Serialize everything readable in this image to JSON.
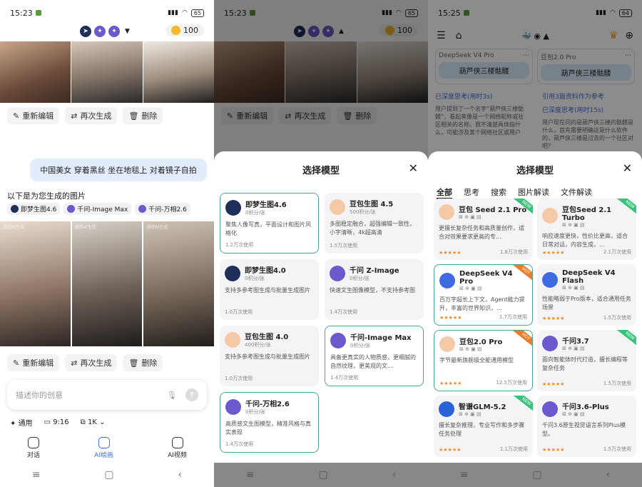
{
  "p1": {
    "time": "15:23",
    "battery": "65",
    "points": "100",
    "actions": [
      "重新编辑",
      "再次生成",
      "删除"
    ],
    "user_prompt": "中国美女 穿着黑丝 坐在地毯上 对着镜子自拍",
    "result_label": "以下是为您生成的图片",
    "model_chips": [
      "即梦生图4.6",
      "千问-Image Max",
      "千问-万相2.6"
    ],
    "watermark": "通用AI生成",
    "prompt_placeholder": "描述你的创意",
    "options": [
      "通用",
      "9:16",
      "1K"
    ],
    "nav_tabs": [
      "对话",
      "AI绘画",
      "AI视频"
    ]
  },
  "p2": {
    "time": "15:23",
    "battery": "65",
    "points": "100",
    "actions": [
      "重新编辑",
      "再次生成",
      "删除"
    ],
    "sheet_title": "选择模型",
    "cards": [
      {
        "name": "即梦生图4.6",
        "price": "0积分/张",
        "desc": "聚焦人像写真，平面设计和图片风格化",
        "uses": "1.2万次使用",
        "selected": true,
        "logo": "jimeng"
      },
      {
        "name": "豆包生图 4.5",
        "price": "500积分/张",
        "desc": "多图稳定融合，超强编辑一致性，小字清晰，4k超高清",
        "uses": "1.5万次使用",
        "selected": false,
        "logo": "doubao"
      },
      {
        "name": "即梦生图4.0",
        "price": "0积分/张",
        "desc": "支持多参考图生成与批量生成图片",
        "uses": "1.0万次使用",
        "selected": false,
        "logo": "jimeng"
      },
      {
        "name": "千问 Z-Image",
        "price": "0积分/张",
        "desc": "快速文生图像模型，不支持参考图",
        "uses": "1.4万次使用",
        "selected": false,
        "logo": "qwen"
      },
      {
        "name": "豆包生图 4.0",
        "price": "400积分/张",
        "desc": "支持多参考图生成与批量生成图片",
        "uses": "1.0万次使用",
        "selected": false,
        "logo": "doubao"
      },
      {
        "name": "千问-Image Max",
        "price": "0积分/张",
        "desc": "具备更真实的人物质感，更细腻的自然纹理，更美观的文...",
        "uses": "1.4万次使用",
        "selected": true,
        "logo": "qwen"
      },
      {
        "name": "千问-万相2.6",
        "price": "0积分/张",
        "desc": "高质感文生图模型，精准风格与真实表现",
        "uses": "1.4万次使用",
        "selected": true,
        "logo": "qwen"
      }
    ]
  },
  "p3": {
    "time": "15:25",
    "battery": "64",
    "compare": [
      {
        "model": "DeepSeek V4 Pro",
        "text": "葫芦侠三楼骷髅"
      },
      {
        "model": "豆包2.0 Pro",
        "text": "葫芦侠三楼骷髅"
      }
    ],
    "think_left": "已深度思考(用时3s)",
    "think_right": "引用3篇资料作为参考",
    "think_right2": "已深度思考(用时15s)",
    "reason_left": "用户提到了一个名字“葫芦侠三楼骷髅”，看起来像是一个网络昵称或社区相关的名称。我不清楚具体指什么，可能涉及某个网络社区或用户",
    "reason_right": "用户现在问的是葫芦侠三楼的骷髅是什么，首先需要明确这是什么软件的，葫芦侠三楼是过去的一个社区对吧？",
    "sheet_title": "选择模型",
    "tabs": [
      "全部",
      "思考",
      "搜索",
      "图片解读",
      "文件解读"
    ],
    "cards": [
      {
        "name": "豆包 Seed 2.1 Pro",
        "desc": "更擅长复杂任务和高质量创作，适合对效果要求更高的专...",
        "uses": "1.8万次使用",
        "badge": "NEW",
        "logo": "doubao",
        "selected": false
      },
      {
        "name": "豆包Seed 2.1 Turbo",
        "desc": "响应速度更快，性价比更高，适合日常对话，内容生成，...",
        "uses": "2.1万次使用",
        "badge": "NEW",
        "logo": "doubao",
        "selected": false
      },
      {
        "name": "DeepSeek V4 Pro",
        "desc": "百万字超长上下文，Agent能力提升，丰富的世界知识，...",
        "uses": "1.7万次使用",
        "badge": "HOT",
        "logo": "deepseek",
        "selected": true
      },
      {
        "name": "DeepSeek V4 Flash",
        "desc": "性能略弱于Pro版本，适合通用任务场景",
        "uses": "1.5万次使用",
        "badge": "",
        "logo": "deepseek",
        "selected": false
      },
      {
        "name": "豆包2.0 Pro",
        "desc": "字节最新旗舰级全能通用模型",
        "uses": "12.5万次使用",
        "badge": "HOT",
        "logo": "doubao",
        "selected": true
      },
      {
        "name": "千问3.7",
        "desc": "面向智能体时代打造，擅长编程等复杂任务",
        "uses": "1.5万次使用",
        "badge": "NEW",
        "logo": "qwen",
        "selected": false
      },
      {
        "name": "智谱GLM-5.2",
        "desc": "擅长复杂推理，专业写作和多步骤任务处理",
        "uses": "1.1万次使用",
        "badge": "NEW",
        "logo": "zhipu",
        "selected": false
      },
      {
        "name": "千问3.6-Plus",
        "desc": "千问3.6原生视觉语言系列Plus模型。",
        "uses": "1.5万次使用",
        "badge": "",
        "logo": "qwen",
        "selected": false
      }
    ]
  },
  "colors": {
    "accent": "#3b6ee8",
    "select_border": "#46a98f",
    "new_badge": "#39c27a",
    "hot_badge": "#f07a28"
  }
}
